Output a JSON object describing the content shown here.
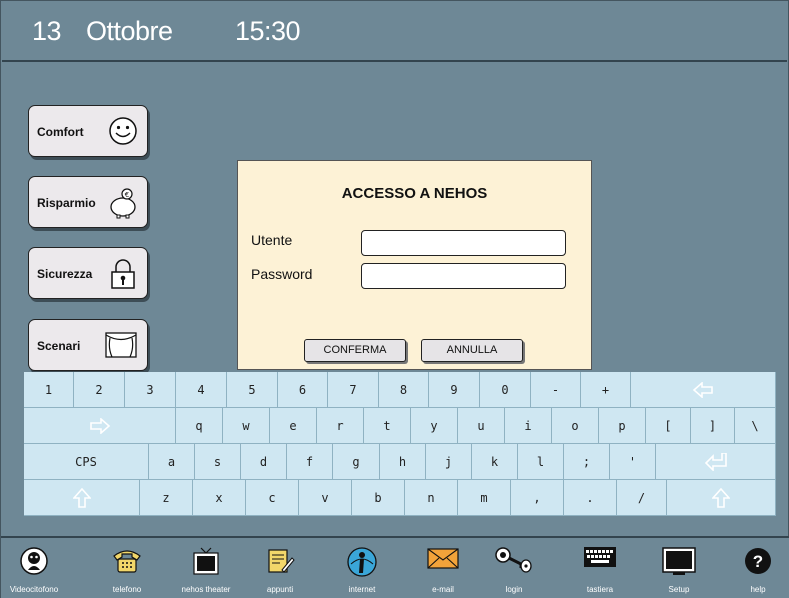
{
  "header": {
    "day": "13",
    "month": "Ottobre",
    "time": "15:30"
  },
  "sidebar": {
    "items": [
      {
        "label": "Comfort",
        "icon": "smiley-icon"
      },
      {
        "label": "Risparmio",
        "icon": "piggy-bank-icon"
      },
      {
        "label": "Sicurezza",
        "icon": "padlock-icon"
      },
      {
        "label": "Scenari",
        "icon": "theater-icon"
      }
    ]
  },
  "dialog": {
    "title": "ACCESSO A NEHOS",
    "user_label": "Utente",
    "password_label": "Password",
    "user_value": "",
    "password_value": "",
    "confirm_label": "CONFERMA",
    "cancel_label": "ANNULLA"
  },
  "keyboard": {
    "rows": [
      [
        "1",
        "2",
        "3",
        "4",
        "5",
        "6",
        "7",
        "8",
        "9",
        "0",
        "-",
        "+",
        "backspace"
      ],
      [
        "tab",
        "q",
        "w",
        "e",
        "r",
        "t",
        "y",
        "u",
        "i",
        "o",
        "p",
        "[",
        "]",
        "\\"
      ],
      [
        "CPS",
        "a",
        "s",
        "d",
        "f",
        "g",
        "h",
        "j",
        "k",
        "l",
        ";",
        "'",
        "enter"
      ],
      [
        "shift",
        "z",
        "x",
        "c",
        "v",
        "b",
        "n",
        "m",
        ",",
        ".",
        "/",
        "shift"
      ]
    ]
  },
  "bottombar": {
    "items": [
      {
        "label": "Videocitofono",
        "icon": "intercom-icon"
      },
      {
        "label": "telefono",
        "icon": "telephone-icon"
      },
      {
        "label": "nehos theater",
        "icon": "tv-icon"
      },
      {
        "label": "appunti",
        "icon": "notepad-icon"
      },
      {
        "label": "internet",
        "icon": "internet-icon"
      },
      {
        "label": "e-mail",
        "icon": "envelope-icon"
      },
      {
        "label": "login",
        "icon": "key-icon"
      },
      {
        "label": "tastiera",
        "icon": "keyboard-icon"
      },
      {
        "label": "Setup",
        "icon": "monitor-icon"
      },
      {
        "label": "help",
        "icon": "help-icon"
      }
    ]
  },
  "colors": {
    "background": "#6e8896",
    "dialog": "#fdf2d6",
    "keyboard_key": "#cfe7f2",
    "button": "#ece9ec"
  }
}
